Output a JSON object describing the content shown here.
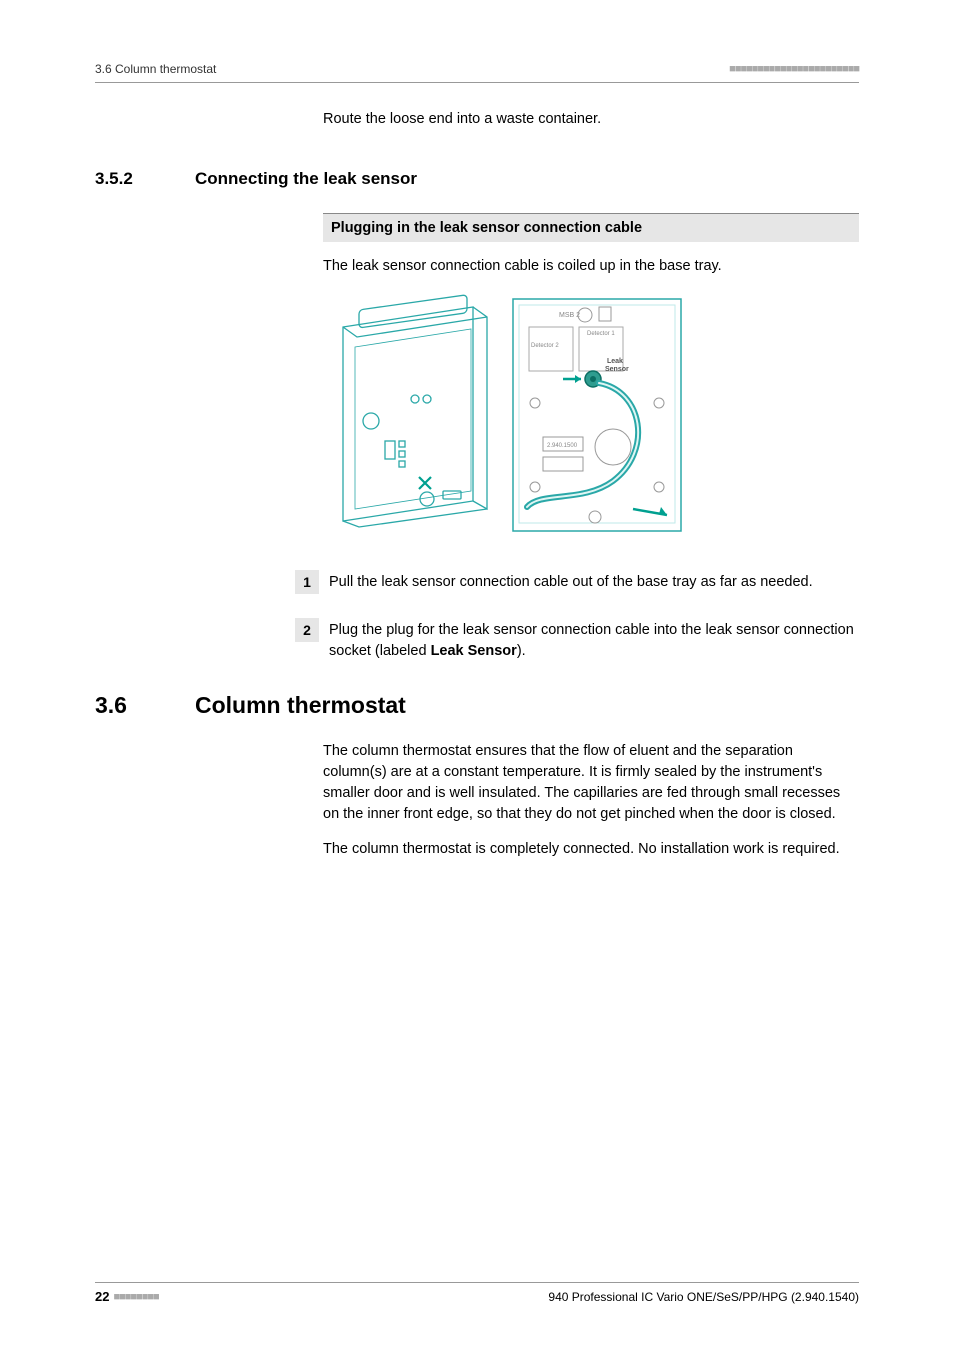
{
  "header": {
    "left": "3.6 Column thermostat",
    "right": "■■■■■■■■■■■■■■■■■■■■■■■"
  },
  "intro": "Route the loose end into a waste container.",
  "subsection": {
    "num": "3.5.2",
    "title": "Connecting the leak sensor"
  },
  "stepTitle": "Plugging in the leak sensor connection cable",
  "preStepText": "The leak sensor connection cable is coiled up in the base tray.",
  "diagram_labels": {
    "msb2": "MSB 2",
    "det1": "Detector 1",
    "det2": "Detector 2",
    "leaksensor_l1": "Leak",
    "leaksensor_l2": "Sensor",
    "model": "2.940.1500"
  },
  "steps": [
    {
      "n": "1",
      "text": "Pull the leak sensor connection cable out of the base tray as far as needed."
    },
    {
      "n": "2",
      "text_pre": "Plug the plug for the leak sensor connection cable into the leak sensor connection socket (labeled ",
      "bold": "Leak Sensor",
      "text_post": ")."
    }
  ],
  "section": {
    "num": "3.6",
    "title": "Column thermostat"
  },
  "para1": "The column thermostat ensures that the flow of eluent and the separation column(s) are at a constant temperature. It is firmly sealed by the instrument's smaller door and is well insulated. The capillaries are fed through small recesses on the inner front edge, so that they do not get pinched when the door is closed.",
  "para2": "The column thermostat is completely connected. No installation work is required.",
  "footer": {
    "page": "22",
    "dots": "■■■■■■■■",
    "right": "940 Professional IC Vario ONE/SeS/PP/HPG (2.940.1540)"
  }
}
